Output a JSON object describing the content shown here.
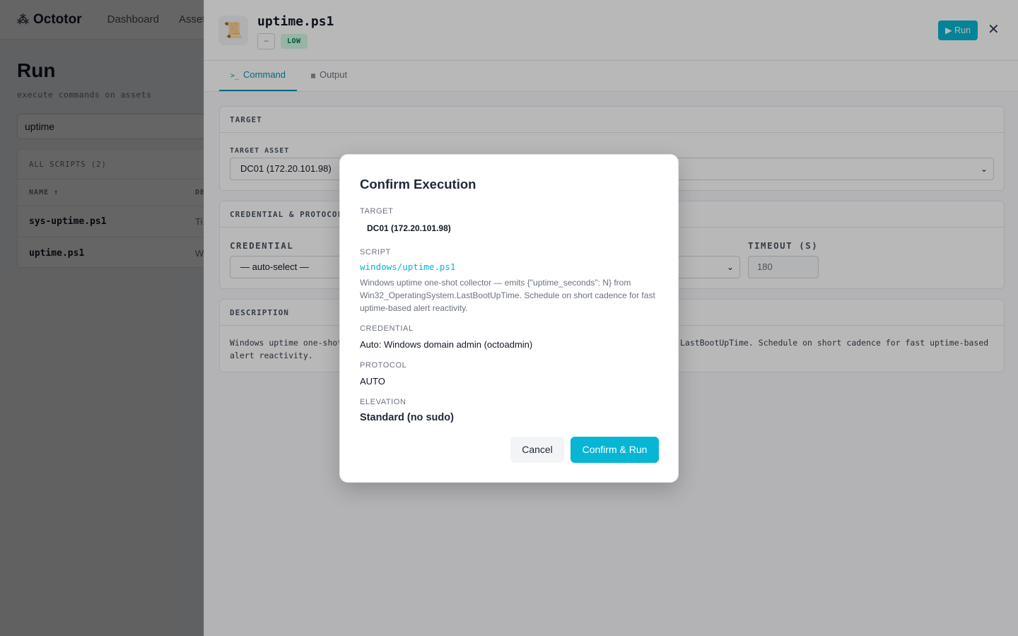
{
  "app": {
    "name": "Octotor",
    "nav": [
      "Dashboard",
      "Assets"
    ]
  },
  "page": {
    "title": "Run",
    "subtitle": "execute commands on assets",
    "search_value": "uptime",
    "scripts_header": "ALL SCRIPTS (2)",
    "columns": [
      "NAME ↑",
      "DE"
    ],
    "rows": [
      {
        "name": "sys-uptime.ps1",
        "desc": "Ti"
      },
      {
        "name": "uptime.ps1",
        "desc": "W"
      }
    ]
  },
  "drawer": {
    "icon": "scroll-icon",
    "title": "uptime.ps1",
    "tag_dash": "–",
    "tag_risk": "LOW",
    "run_label": "▶ Run",
    "close_label": "✕",
    "tabs": [
      {
        "icon": ">_",
        "label": "Command"
      },
      {
        "icon": "▦",
        "label": "Output"
      }
    ],
    "target_section": {
      "header": "TARGET",
      "field_label": "TARGET ASSET",
      "value": "DC01 (172.20.101.98)"
    },
    "cred_section": {
      "header": "CREDENTIAL & PROTOCOL",
      "credential_label": "CREDENTIAL",
      "credential_value": "— auto-select —",
      "timeout_label": "TIMEOUT (S)",
      "timeout_value": "180"
    },
    "desc_section": {
      "header": "DESCRIPTION",
      "text_left": "Windows uptime one-shot",
      "text_right": "LastBootUpTime. Schedule on short cadence for fast uptime-based",
      "text_line2": "alert reactivity."
    }
  },
  "modal": {
    "title": "Confirm Execution",
    "target_label": "TARGET",
    "target_value": "DC01 (172.20.101.98)",
    "script_label": "SCRIPT",
    "script_path": "windows/uptime.ps1",
    "script_desc": "Windows uptime one-shot collector — emits {\"uptime_seconds\": N} from Win32_OperatingSystem.LastBootUpTime. Schedule on short cadence for fast uptime-based alert reactivity.",
    "credential_label": "CREDENTIAL",
    "credential_value": "Auto: Windows domain admin (octoadmin)",
    "protocol_label": "PROTOCOL",
    "protocol_value": "AUTO",
    "elevation_label": "ELEVATION",
    "elevation_value": "Standard (no sudo)",
    "cancel_label": "Cancel",
    "confirm_label": "Confirm & Run"
  },
  "colors": {
    "accent": "#06b6d4",
    "risk_low_bg": "#d1fae5",
    "risk_low_fg": "#047857"
  }
}
